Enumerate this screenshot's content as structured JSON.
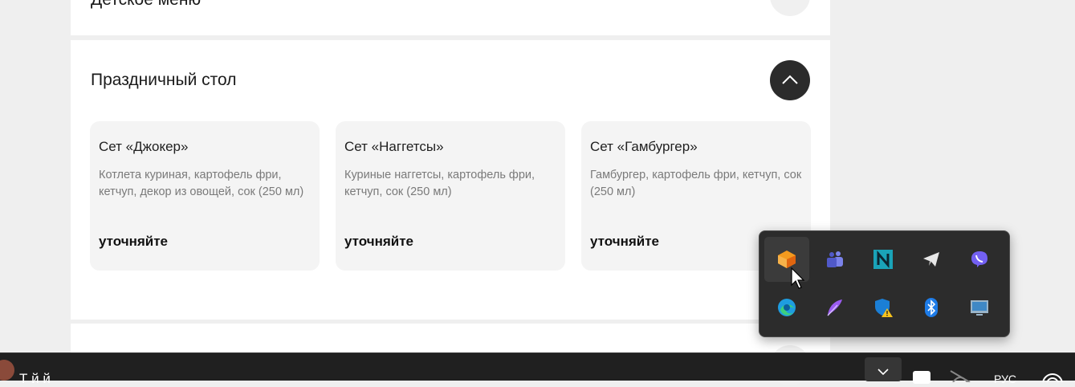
{
  "sections": {
    "kids": {
      "title": "Детское меню"
    },
    "holiday": {
      "title": "Праздничный стол",
      "cards": [
        {
          "name": "Сет «Джокер»",
          "description": "Котлета куриная, картофель фри, кетчуп, декор из овощей, сок (250 мл)",
          "price": "уточняйте"
        },
        {
          "name": "Сет «Наггетсы»",
          "description": "Куриные наггетсы, картофель фри, кетчуп, сок (250 мл)",
          "price": "уточняйте"
        },
        {
          "name": "Сет «Гамбургер»",
          "description": "Гамбургер, картофель фри, кетчуп, сок (250 мл)",
          "price": "уточняйте"
        }
      ]
    }
  },
  "taskbar": {
    "window_title": "Т                  й    й",
    "language": "РУС"
  },
  "tray_popup": {
    "icons": [
      "app-icon-orange",
      "teams-icon",
      "n-app-icon",
      "telegram-icon",
      "viber-icon",
      "edge-icon",
      "feather-icon",
      "defender-warning-icon",
      "bluetooth-icon",
      "display-icon"
    ]
  },
  "colors": {
    "accent_dark": "#2b2b2b",
    "card_bg": "#f4f4f4",
    "page_bg": "#efefef",
    "taskbar_bg": "#202020"
  }
}
